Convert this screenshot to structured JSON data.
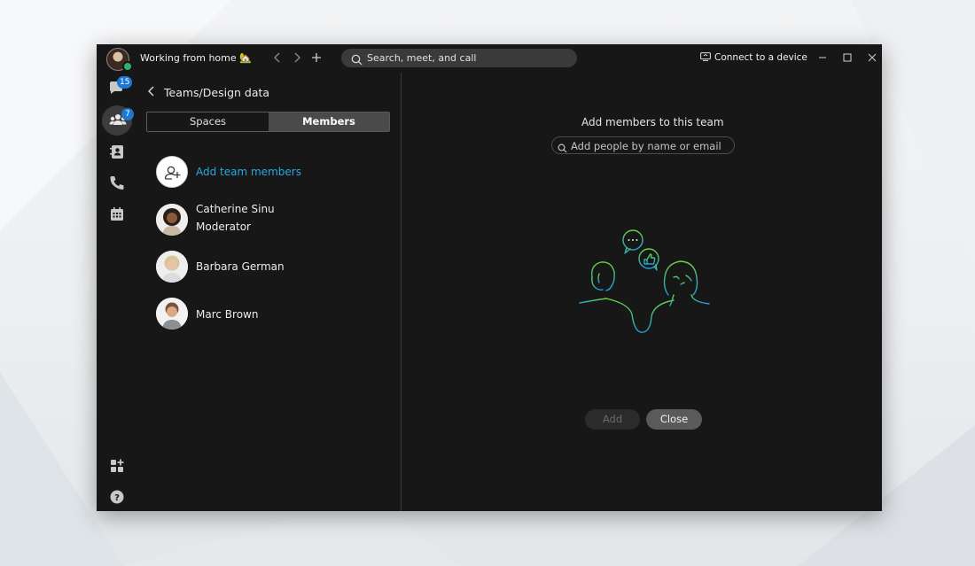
{
  "titlebar": {
    "status": "Working from home 🏡",
    "search_placeholder": "Search, meet, and call",
    "connect_label": "Connect to a device"
  },
  "rail": {
    "messaging_badge": "15",
    "teams_badge": "7",
    "icons": [
      "messaging-icon",
      "teams-icon",
      "contacts-icon",
      "calling-icon",
      "meetings-icon",
      "apps-icon",
      "help-icon"
    ]
  },
  "panel": {
    "breadcrumb": "Teams/Design data",
    "tabs": [
      "Spaces",
      "Members"
    ],
    "selected_tab": "Members",
    "add_label": "Add team members",
    "members": [
      {
        "name": "Catherine Sinu",
        "role": "Moderator"
      },
      {
        "name": "Barbara German",
        "role": ""
      },
      {
        "name": "Marc Brown",
        "role": ""
      }
    ]
  },
  "main": {
    "title": "Add members to this team",
    "input_placeholder": "Add people by name or email",
    "add_button": "Add",
    "close_button": "Close"
  },
  "colors": {
    "accent_link": "#28a8e0",
    "badge": "#1b79d3",
    "presence": "#2fb16d",
    "window_bg": "#171717"
  }
}
